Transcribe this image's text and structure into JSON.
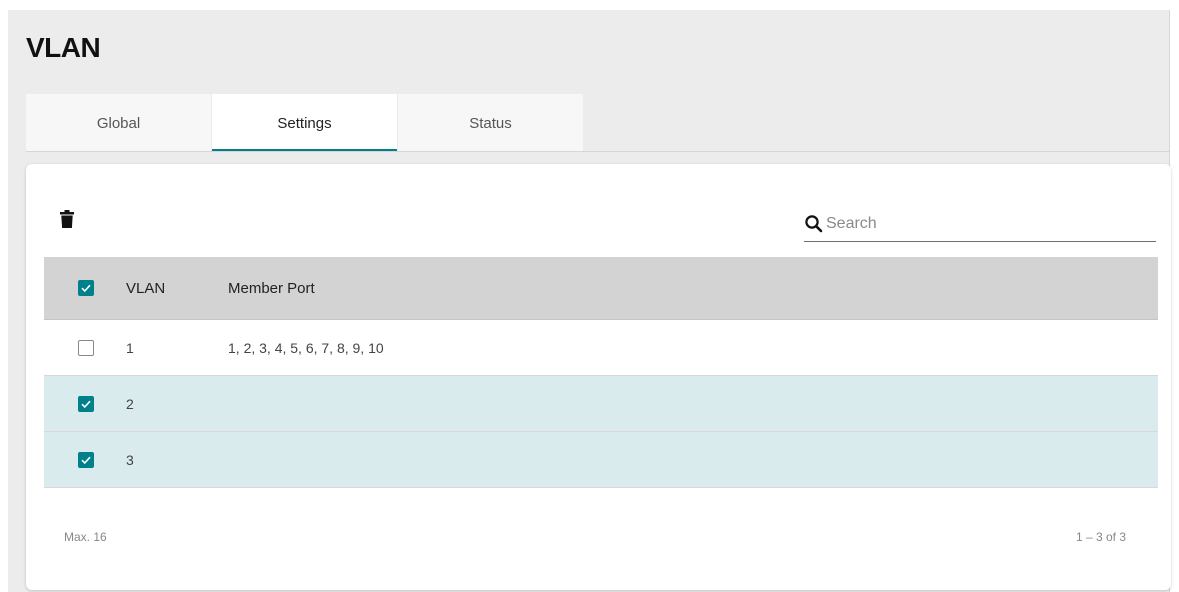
{
  "page": {
    "title": "VLAN"
  },
  "tabs": [
    {
      "label": "Global",
      "active": false
    },
    {
      "label": "Settings",
      "active": true
    },
    {
      "label": "Status",
      "active": false
    }
  ],
  "toolbar": {
    "delete_icon": "trash-icon",
    "search": {
      "icon": "search-icon",
      "placeholder": "Search",
      "value": ""
    }
  },
  "table": {
    "header": {
      "select_all_checked": true,
      "columns": [
        "VLAN",
        "Member Port"
      ]
    },
    "rows": [
      {
        "checked": false,
        "vlan": "1",
        "member_port": "1, 2, 3, 4, 5, 6, 7, 8, 9, 10"
      },
      {
        "checked": true,
        "vlan": "2",
        "member_port": ""
      },
      {
        "checked": true,
        "vlan": "3",
        "member_port": ""
      }
    ]
  },
  "footer": {
    "max_label": "Max. 16",
    "pagination": "1 – 3 of 3"
  },
  "colors": {
    "accent": "#00808a",
    "selected_row": "#d9ebec",
    "header_bg": "#d3d3d3"
  }
}
